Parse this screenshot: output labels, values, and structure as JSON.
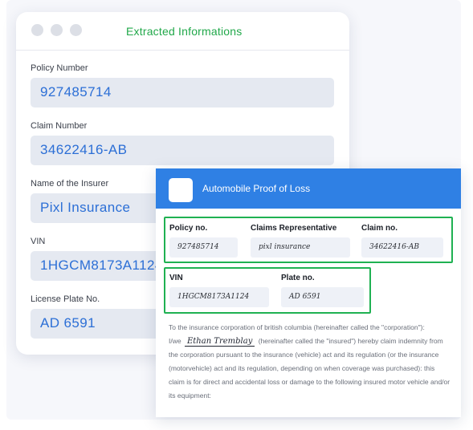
{
  "extracted": {
    "title": "Extracted Informations",
    "fields": [
      {
        "label": "Policy Number",
        "value": "927485714"
      },
      {
        "label": "Claim Number",
        "value": "34622416-AB"
      },
      {
        "label": "Name of the Insurer",
        "value": "Pixl Insurance"
      },
      {
        "label": "VIN",
        "value": "1HGCM8173A1124"
      },
      {
        "label": "License Plate No.",
        "value": "AD 6591"
      }
    ]
  },
  "document": {
    "title": "Automobile Proof of Loss",
    "row1": {
      "policy_label": "Policy no.",
      "policy_value": "927485714",
      "rep_label": "Claims  Representative",
      "rep_value": "pixl insurance",
      "claim_label": "Claim no.",
      "claim_value": "34622416-AB"
    },
    "row2": {
      "vin_label": "VIN",
      "vin_value": "1HGCM8173A1124",
      "plate_label": "Plate no.",
      "plate_value": "AD 6591"
    },
    "paragraph_start": "To the insurance corporation of british columbia (hereinafter called the \"corporation\"):",
    "iwe": "I/we",
    "signature": "Ethan Tremblay",
    "paragraph_rest": "(hereinafter called the \"insured\") hereby claim indemnity from the corporation pursuant to the insurance (vehicle) act and its regulation (or the insurance (motorvehicle) act and its regulation, depending on when coverage was purchased): this claim is for direct and accidental loss or damage to the following insured motor vehicle and/or its equipment:"
  }
}
